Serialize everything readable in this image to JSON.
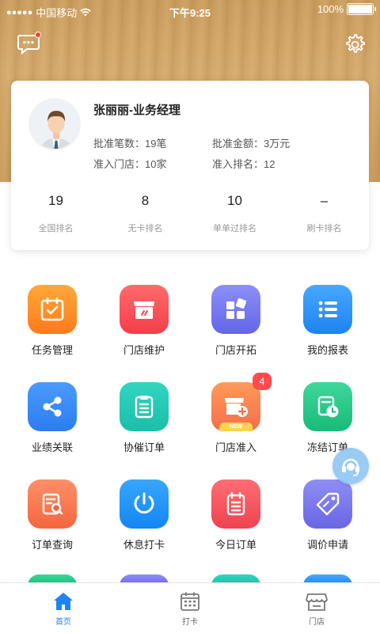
{
  "status_bar": {
    "carrier": "中国移动",
    "time": "下午9:25",
    "battery": "100%"
  },
  "profile": {
    "name": "张丽丽-业务经理",
    "approved_count": "批准笔数：19笔",
    "approved_amount": "批准金额：3万元",
    "stores_admitted": "准入门店：10家",
    "admit_rank": "准入排名：12"
  },
  "stats": [
    {
      "value": "19",
      "label": "全国排名"
    },
    {
      "value": "8",
      "label": "无卡排名"
    },
    {
      "value": "10",
      "label": "单单过排名"
    },
    {
      "value": "–",
      "label": "刷卡排名"
    }
  ],
  "menu": [
    {
      "label": "任务管理",
      "icon": "calendar-check-icon"
    },
    {
      "label": "门店维护",
      "icon": "store-icon"
    },
    {
      "label": "门店开拓",
      "icon": "blocks-icon"
    },
    {
      "label": "我的报表",
      "icon": "list-icon"
    },
    {
      "label": "业绩关联",
      "icon": "share-icon"
    },
    {
      "label": "协催订单",
      "icon": "clipboard-icon"
    },
    {
      "label": "门店准入",
      "icon": "store-add-icon",
      "badge": "4",
      "tag": "NEW"
    },
    {
      "label": "冻结订单",
      "icon": "clock-doc-icon"
    },
    {
      "label": "订单查询",
      "icon": "search-doc-icon"
    },
    {
      "label": "休息打卡",
      "icon": "power-icon"
    },
    {
      "label": "今日订单",
      "icon": "notebook-icon"
    },
    {
      "label": "调价申请",
      "icon": "price-tag-icon"
    }
  ],
  "tabs": [
    {
      "label": "首页",
      "icon": "home-icon",
      "active": true
    },
    {
      "label": "打卡",
      "icon": "calendar-grid-icon",
      "active": false
    },
    {
      "label": "门店",
      "icon": "shop-icon",
      "active": false
    }
  ],
  "colors": {
    "accent": "#1f83f0",
    "badge": "#ff4d4f"
  }
}
